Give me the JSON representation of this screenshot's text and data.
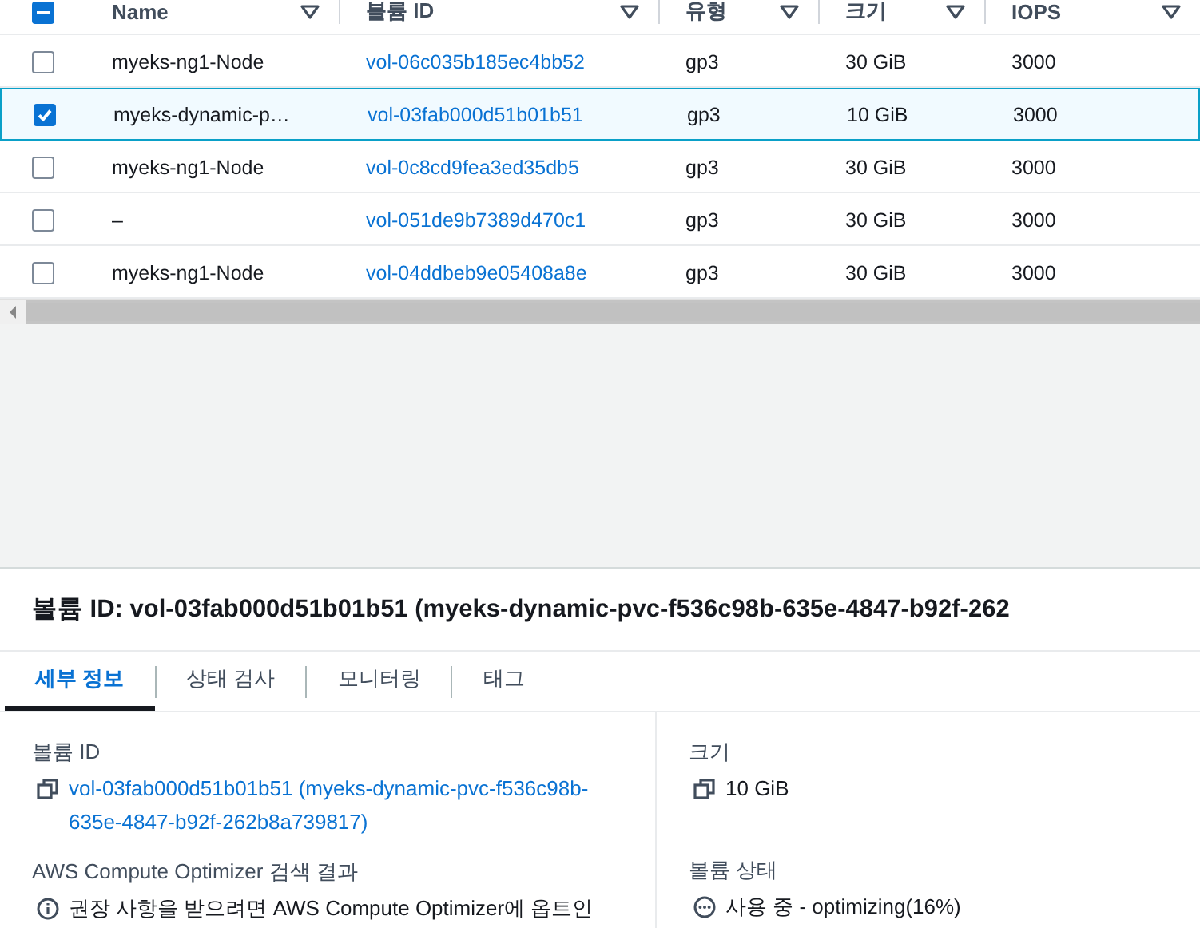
{
  "table": {
    "select_all_indeterminate": true,
    "columns": [
      {
        "label": "Name"
      },
      {
        "label": "볼륨 ID"
      },
      {
        "label": "유형"
      },
      {
        "label": "크기"
      },
      {
        "label": "IOPS"
      }
    ],
    "rows": [
      {
        "selected": false,
        "name": "myeks-ng1-Node",
        "volume_id": "vol-06c035b185ec4bb52",
        "type": "gp3",
        "size": "30 GiB",
        "iops": "3000"
      },
      {
        "selected": true,
        "name": "myeks-dynamic-p…",
        "volume_id": "vol-03fab000d51b01b51",
        "type": "gp3",
        "size": "10 GiB",
        "iops": "3000"
      },
      {
        "selected": false,
        "name": "myeks-ng1-Node",
        "volume_id": "vol-0c8cd9fea3ed35db5",
        "type": "gp3",
        "size": "30 GiB",
        "iops": "3000"
      },
      {
        "selected": false,
        "name": "–",
        "volume_id": "vol-051de9b7389d470c1",
        "type": "gp3",
        "size": "30 GiB",
        "iops": "3000"
      },
      {
        "selected": false,
        "name": "myeks-ng1-Node",
        "volume_id": "vol-04ddbeb9e05408a8e",
        "type": "gp3",
        "size": "30 GiB",
        "iops": "3000"
      }
    ]
  },
  "detail": {
    "title": "볼륨 ID: vol-03fab000d51b01b51 (myeks-dynamic-pvc-f536c98b-635e-4847-b92f-262",
    "tabs": [
      {
        "label": "세부 정보",
        "selected": true
      },
      {
        "label": "상태 검사",
        "selected": false
      },
      {
        "label": "모니터링",
        "selected": false
      },
      {
        "label": "태그",
        "selected": false
      }
    ],
    "left": [
      {
        "label": "볼륨 ID",
        "kind": "copy",
        "value": "vol-03fab000d51b01b51 (myeks-dynamic-pvc-f536c98b-635e-4847-b92f-262b8a739817)"
      },
      {
        "label": "AWS Compute Optimizer 검색 결과",
        "kind": "info",
        "value": "권장 사항을 받으려면 AWS Compute Optimizer에 옵트인"
      }
    ],
    "right": [
      {
        "label": "크기",
        "kind": "copy",
        "value": "10 GiB"
      },
      {
        "label": "볼륨 상태",
        "kind": "status",
        "value": "사용 중 - optimizing(16%)"
      }
    ]
  }
}
